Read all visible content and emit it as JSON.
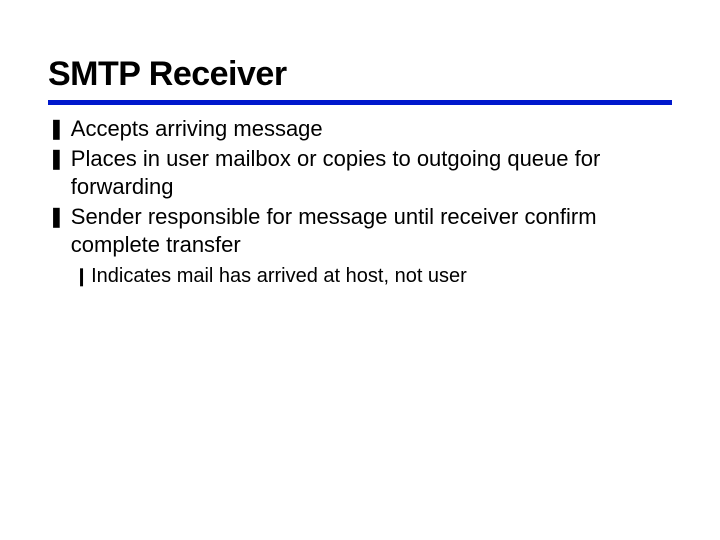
{
  "slide": {
    "title": "SMTP Receiver",
    "bullets": [
      {
        "marker": "❚",
        "text": "Accepts arriving message"
      },
      {
        "marker": "❚",
        "text": "Places in user mailbox or copies to outgoing queue for forwarding"
      },
      {
        "marker": "❚",
        "text": "Sender responsible for message until receiver confirm complete transfer"
      }
    ],
    "subbullets": [
      {
        "marker": "❙",
        "text": "Indicates mail has arrived at host, not user"
      }
    ]
  }
}
